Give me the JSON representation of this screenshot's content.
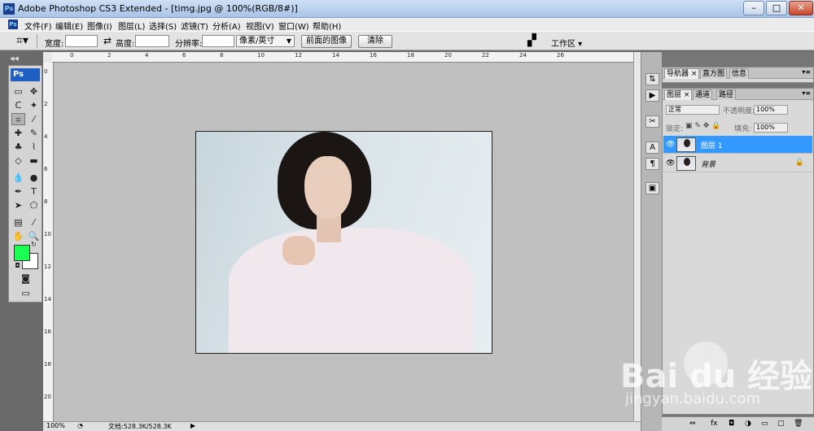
{
  "window": {
    "title": "Adobe Photoshop CS3 Extended - [timg.jpg @ 100%(RGB/8#)]",
    "app_icon_text": "Ps",
    "minimize": "–",
    "maximize": "□",
    "close": "✕"
  },
  "menu": [
    "文件(F)",
    "编辑(E)",
    "图像(I)",
    "图层(L)",
    "选择(S)",
    "滤镜(T)",
    "分析(A)",
    "视图(V)",
    "窗口(W)",
    "帮助(H)"
  ],
  "options": {
    "width_label": "宽度:",
    "height_label": "高度:",
    "resolution_label": "分辨率:",
    "unit_select": "像素/英寸",
    "front_image_button": "前面的图像",
    "clear_button": "清除",
    "workspace_label": "工作区 ▾"
  },
  "toolbox": {
    "logo": "Ps",
    "tools": [
      {
        "icon": "▭",
        "name": "marquee-icon"
      },
      {
        "icon": "✥",
        "name": "move-icon"
      },
      {
        "icon": "ᑕ",
        "name": "lasso-icon"
      },
      {
        "icon": "✦",
        "name": "magic-wand-icon"
      },
      {
        "icon": "⌗",
        "name": "crop-icon",
        "active": true
      },
      {
        "icon": "⁄",
        "name": "slice-icon"
      },
      {
        "icon": "✚",
        "name": "healing-icon"
      },
      {
        "icon": "✎",
        "name": "brush-icon"
      },
      {
        "icon": "♣",
        "name": "stamp-icon"
      },
      {
        "icon": "⌇",
        "name": "history-brush-icon"
      },
      {
        "icon": "◇",
        "name": "eraser-icon"
      },
      {
        "icon": "▬",
        "name": "gradient-icon"
      },
      {
        "icon": "💧",
        "name": "blur-icon"
      },
      {
        "icon": "●",
        "name": "dodge-icon"
      },
      {
        "icon": "✒",
        "name": "pen-icon"
      },
      {
        "icon": "T",
        "name": "type-icon"
      },
      {
        "icon": "➤",
        "name": "path-select-icon"
      },
      {
        "icon": "⬠",
        "name": "shape-icon"
      },
      {
        "icon": "▤",
        "name": "notes-icon"
      },
      {
        "icon": "⁄",
        "name": "eyedropper-icon"
      },
      {
        "icon": "✋",
        "name": "hand-icon"
      },
      {
        "icon": "🔍",
        "name": "zoom-icon"
      }
    ],
    "foreground_color": "#1cff52",
    "background_color": "#ffffff"
  },
  "ruler_h": [
    "0",
    "2",
    "4",
    "6",
    "8",
    "10",
    "12",
    "14",
    "16",
    "18",
    "20",
    "22",
    "24",
    "26"
  ],
  "ruler_v": [
    "0",
    "2",
    "4",
    "6",
    "8",
    "10",
    "12",
    "14",
    "16",
    "18",
    "20",
    "22"
  ],
  "status": {
    "zoom": "100%",
    "doc": "文档:528.3K/528.3K"
  },
  "dock_icons": [
    "⇅",
    "▶",
    "✂",
    "A",
    "¶",
    "▣"
  ],
  "nav_panel": {
    "tabs": [
      "导航器 ×",
      "直方图",
      "信息"
    ]
  },
  "layers_panel": {
    "tabs": [
      "图层 ×",
      "通道",
      "路径"
    ],
    "blend_mode": "正常",
    "opacity_label": "不透明度:",
    "opacity_value": "100%",
    "lock_label": "锁定:",
    "fill_label": "填充:",
    "fill_value": "100%",
    "layers": [
      {
        "name": "图层 1",
        "selected": true
      },
      {
        "name": "背景",
        "selected": false,
        "locked": true
      }
    ]
  },
  "panel_bottom_icons": [
    "⇔",
    "fx",
    "◘",
    "◑",
    "▭",
    "▢",
    "🗑"
  ],
  "watermark": {
    "logo": "Bai du 经验",
    "url": "jingyan.baidu.com"
  }
}
